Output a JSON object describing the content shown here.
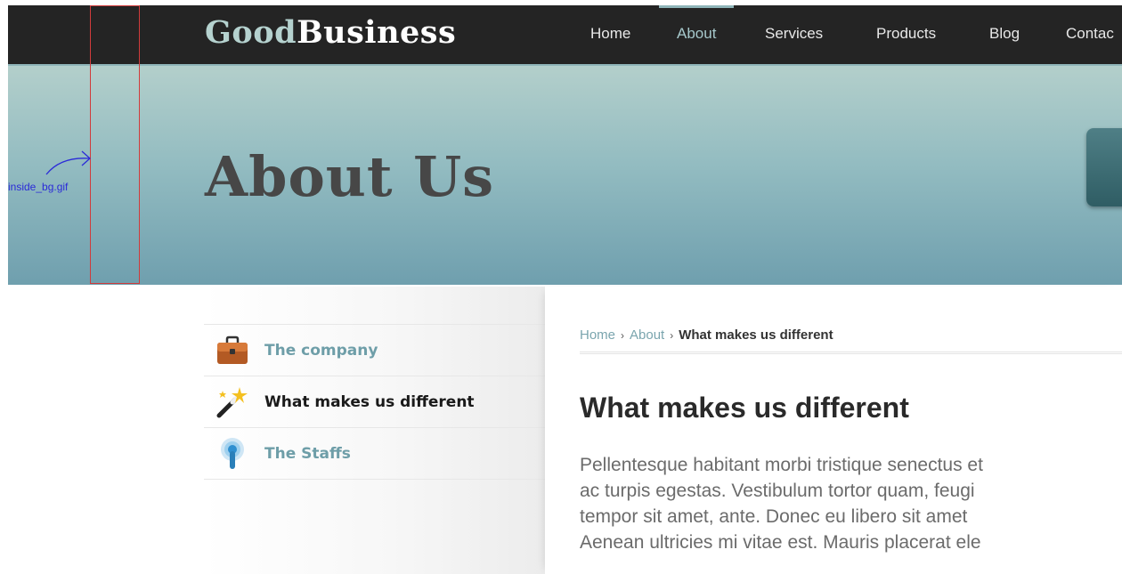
{
  "header": {
    "logo_part1": "Good",
    "logo_part2": "Business",
    "nav": [
      "Home",
      "About",
      "Services",
      "Products",
      "Blog",
      "Contac"
    ],
    "active": "About"
  },
  "hero": {
    "title": "About Us"
  },
  "annotation": {
    "label": "inside_bg.gif"
  },
  "sidebar": {
    "items": [
      {
        "label": "The company",
        "icon": "briefcase-icon"
      },
      {
        "label": "What makes us different",
        "icon": "magic-wand-icon"
      },
      {
        "label": "The Staffs",
        "icon": "broadcast-icon"
      }
    ],
    "current": "What makes us different"
  },
  "main": {
    "breadcrumb": {
      "home": "Home",
      "about": "About",
      "current": "What makes us different",
      "sep": "›"
    },
    "title": "What makes us different",
    "body_lines": [
      "Pellentesque habitant morbi tristique senectus et",
      "ac turpis egestas. Vestibulum tortor quam, feugi",
      "tempor sit amet, ante. Donec eu libero sit amet",
      "Aenean ultricies mi vitae est. Mauris placerat ele"
    ]
  },
  "colors": {
    "nav_bg": "#242424",
    "accent": "#8fb5b9",
    "link": "#6e9ea8"
  }
}
